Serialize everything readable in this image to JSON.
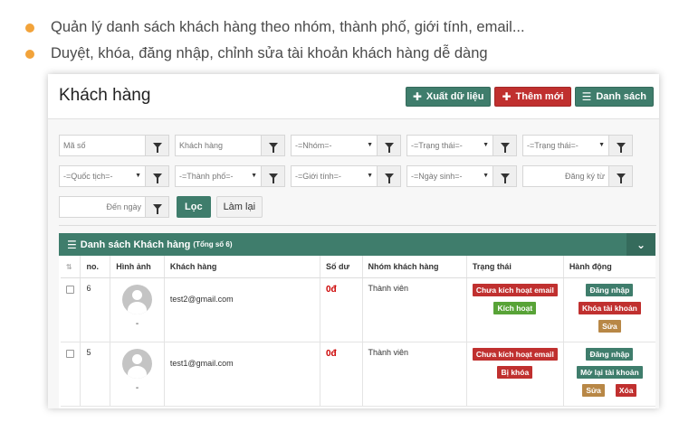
{
  "bullets": [
    "Quản lý danh sách khách hàng theo nhóm, thành phố, giới tính, email...",
    "Duyệt, khóa, đăng nhập, chỉnh sửa tài khoản khách hàng dễ dàng"
  ],
  "header": {
    "title": "Khách hàng",
    "export_label": "Xuất dữ liệu",
    "add_label": "Thêm mới",
    "list_label": "Danh sách"
  },
  "filters": {
    "code_placeholder": "Mã số",
    "customer_placeholder": "Khách hàng",
    "group_select": "-=Nhóm=-",
    "status_select_1": "-=Trạng thái=-",
    "status_select_2": "-=Trạng thái=-",
    "country_select": "-=Quốc tịch=-",
    "city_select": "-=Thành phố=-",
    "gender_select": "-=Giới tính=-",
    "birthday_select": "-=Ngày sinh=-",
    "register_from_placeholder": "Đăng ký từ",
    "to_date_placeholder": "Đến ngày",
    "filter_button": "Lọc",
    "reset_button": "Làm lại"
  },
  "panel": {
    "title": "Danh sách Khách hàng",
    "count": "(Tổng số 6)"
  },
  "table": {
    "columns": [
      "no.",
      "Hình ảnh",
      "Khách hàng",
      "Số dư",
      "Nhóm khách hàng",
      "Trạng thái",
      "Hành động"
    ],
    "rows": [
      {
        "no": "6",
        "avatar_caption": "-",
        "email": "test2@gmail.com",
        "balance": "0đ",
        "group": "Thành viên",
        "status": [
          "Chưa kích hoạt email",
          "Kích hoạt"
        ],
        "actions": [
          "Đăng nhập",
          "Khóa tài khoản",
          "Sửa"
        ]
      },
      {
        "no": "5",
        "avatar_caption": "-",
        "email": "test1@gmail.com",
        "balance": "0đ",
        "group": "Thành viên",
        "status": [
          "Chưa kích hoạt email",
          "Bị khóa"
        ],
        "actions": [
          "Đăng nhập",
          "Mở lại tài khoản",
          "Sửa",
          "Xóa"
        ]
      }
    ]
  },
  "colors": {
    "bullet": "#f2a33a",
    "primary": "#3f7d6c",
    "danger": "#c0302f",
    "success": "#58a337",
    "warning": "#b88746"
  }
}
